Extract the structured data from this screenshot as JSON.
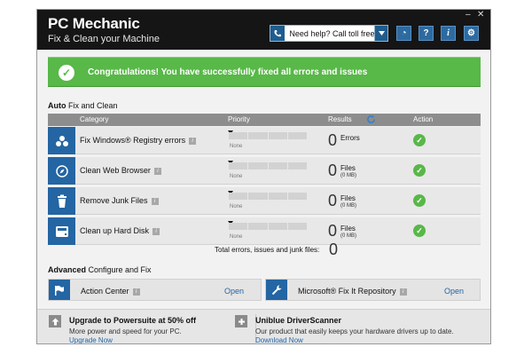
{
  "window": {
    "title": "PC Mechanic",
    "subtitle": "Fix & Clean your Machine",
    "minimize": "–",
    "close": "✕"
  },
  "toolbar": {
    "help_label": "Need help? Call toll free",
    "buttons": [
      {
        "icon": "pie-chart-icon",
        "glyph": "◔"
      },
      {
        "icon": "question-icon",
        "glyph": "?"
      },
      {
        "icon": "info-icon",
        "glyph": "i"
      },
      {
        "icon": "gear-icon",
        "glyph": "⚙"
      }
    ]
  },
  "banner": {
    "message": "Congratulations! You have successfully fixed all errors and issues"
  },
  "auto": {
    "heading_bold": "Auto",
    "heading_rest": " Fix and Clean",
    "columns": {
      "category": "Category",
      "priority": "Priority",
      "results": "Results",
      "action": "Action"
    },
    "rows": [
      {
        "name": "Fix Windows® Registry errors",
        "icon": "registry-cubes-icon",
        "priority": "None",
        "count": "0",
        "unit": "Errors",
        "size": ""
      },
      {
        "name": "Clean Web Browser",
        "icon": "compass-icon",
        "priority": "None",
        "count": "0",
        "unit": "Files",
        "size": "(0 MB)"
      },
      {
        "name": "Remove Junk Files",
        "icon": "trash-icon",
        "priority": "None",
        "count": "0",
        "unit": "Files",
        "size": "(0 MB)"
      },
      {
        "name": "Clean up Hard Disk",
        "icon": "disk-drive-icon",
        "priority": "None",
        "count": "0",
        "unit": "Files",
        "size": "(0 MB)"
      }
    ],
    "total_label": "Total errors, issues and junk files:",
    "total_value": "0"
  },
  "advanced": {
    "heading_bold": "Advanced",
    "heading_rest": " Configure and Fix",
    "items": [
      {
        "name": "Action Center",
        "icon": "flag-icon",
        "link": "Open"
      },
      {
        "name": "Microsoft® Fix It Repository",
        "icon": "wrench-icon",
        "link": "Open"
      }
    ]
  },
  "footer": {
    "promos": [
      {
        "title": "Upgrade to Powersuite at 50% off",
        "desc": "More power and speed for your PC.",
        "link": "Upgrade Now",
        "icon": "arrow-up-icon"
      },
      {
        "title": "Uniblue DriverScanner",
        "desc": "Our product that easily keeps your hardware drivers up to date.",
        "link": "Download Now",
        "icon": "plus-icon"
      }
    ]
  },
  "colors": {
    "accent": "#2465a3",
    "success": "#58b848",
    "header": "#151515"
  }
}
